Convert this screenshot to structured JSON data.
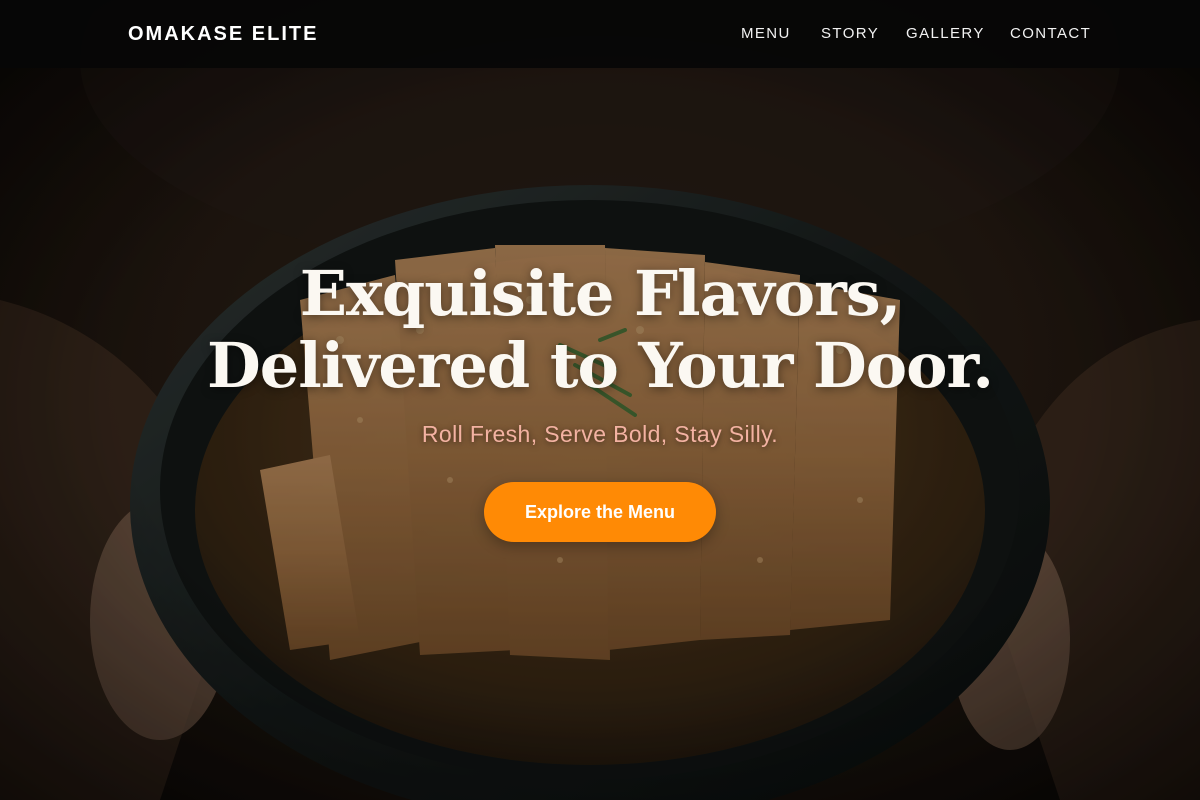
{
  "brand": {
    "name": "OMAKASE ELITE"
  },
  "nav": {
    "items": [
      {
        "label": "MENU"
      },
      {
        "label": "STORY"
      },
      {
        "label": "GALLERY"
      },
      {
        "label": "CONTACT"
      }
    ]
  },
  "hero": {
    "headline_line1": "Exquisite Flavors,",
    "headline_line2": "Delivered to Your Door.",
    "tagline": "Roll Fresh, Serve Bold, Stay Silly.",
    "cta_label": "Explore the Menu"
  },
  "colors": {
    "accent": "#ff8a05",
    "tagline": "#f3b2a2",
    "nav_background": "#060606"
  },
  "images": {
    "hero_background": "photo-katsu-bowl-held-in-hands"
  }
}
